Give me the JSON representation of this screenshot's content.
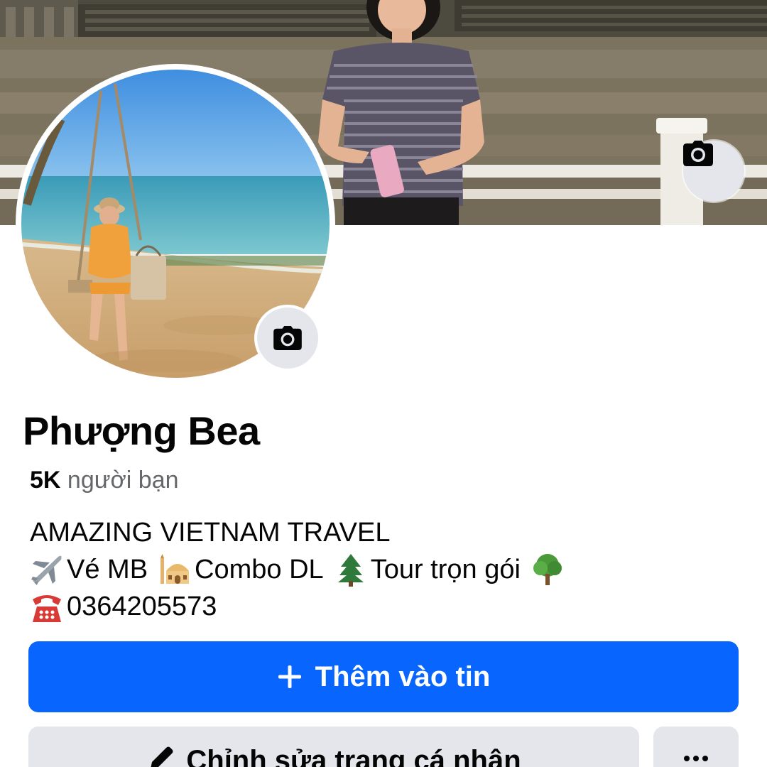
{
  "profile": {
    "name": "Phượng Bea",
    "friends_count": "5K",
    "friends_label": "người bạn"
  },
  "bio": {
    "line1": "AMAZING VIETNAM TRAVEL",
    "line2_a": "Vé MB",
    "line2_b": "Combo DL",
    "line2_c": "Tour trọn gói",
    "line3": "0364205573",
    "emoji": {
      "airplane": "airplane-icon",
      "mosque": "mosque-icon",
      "evergreen": "evergreen-tree-icon",
      "tree": "deciduous-tree-icon",
      "telephone": "telephone-icon"
    }
  },
  "actions": {
    "add_story_label": "Thêm vào tin",
    "edit_profile_label": "Chỉnh sửa trang cá nhân",
    "more_label": "..."
  },
  "icons": {
    "cover_camera": "camera-icon",
    "avatar_camera": "camera-icon",
    "add": "plus-icon",
    "edit": "pencil-icon",
    "more": "more-icon"
  },
  "colors": {
    "primary": "#0866ff",
    "secondary_bg": "#e4e6eb",
    "text_primary": "#050505",
    "text_secondary": "#65676b"
  }
}
